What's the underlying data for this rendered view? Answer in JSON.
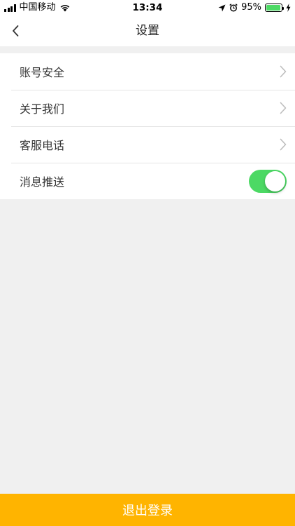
{
  "status_bar": {
    "carrier": "中国移动",
    "time": "13:34",
    "battery_percent_text": "95%",
    "battery_level": 0.95
  },
  "nav": {
    "title": "设置"
  },
  "settings": {
    "items": [
      {
        "label": "账号安全",
        "control": "chevron"
      },
      {
        "label": "关于我们",
        "control": "chevron"
      },
      {
        "label": "客服电话",
        "control": "chevron"
      },
      {
        "label": "消息推送",
        "control": "toggle",
        "enabled": true
      }
    ]
  },
  "logout": {
    "label": "退出登录"
  },
  "colors": {
    "accent": "#ffb400",
    "toggle_on": "#4cd964",
    "background": "#f0f0f0"
  },
  "icons": [
    "back-chevron-icon",
    "chevron-right-icon",
    "wifi-icon",
    "location-arrow-icon",
    "alarm-clock-icon",
    "battery-icon",
    "charging-bolt-icon",
    "signal-bars-icon"
  ]
}
